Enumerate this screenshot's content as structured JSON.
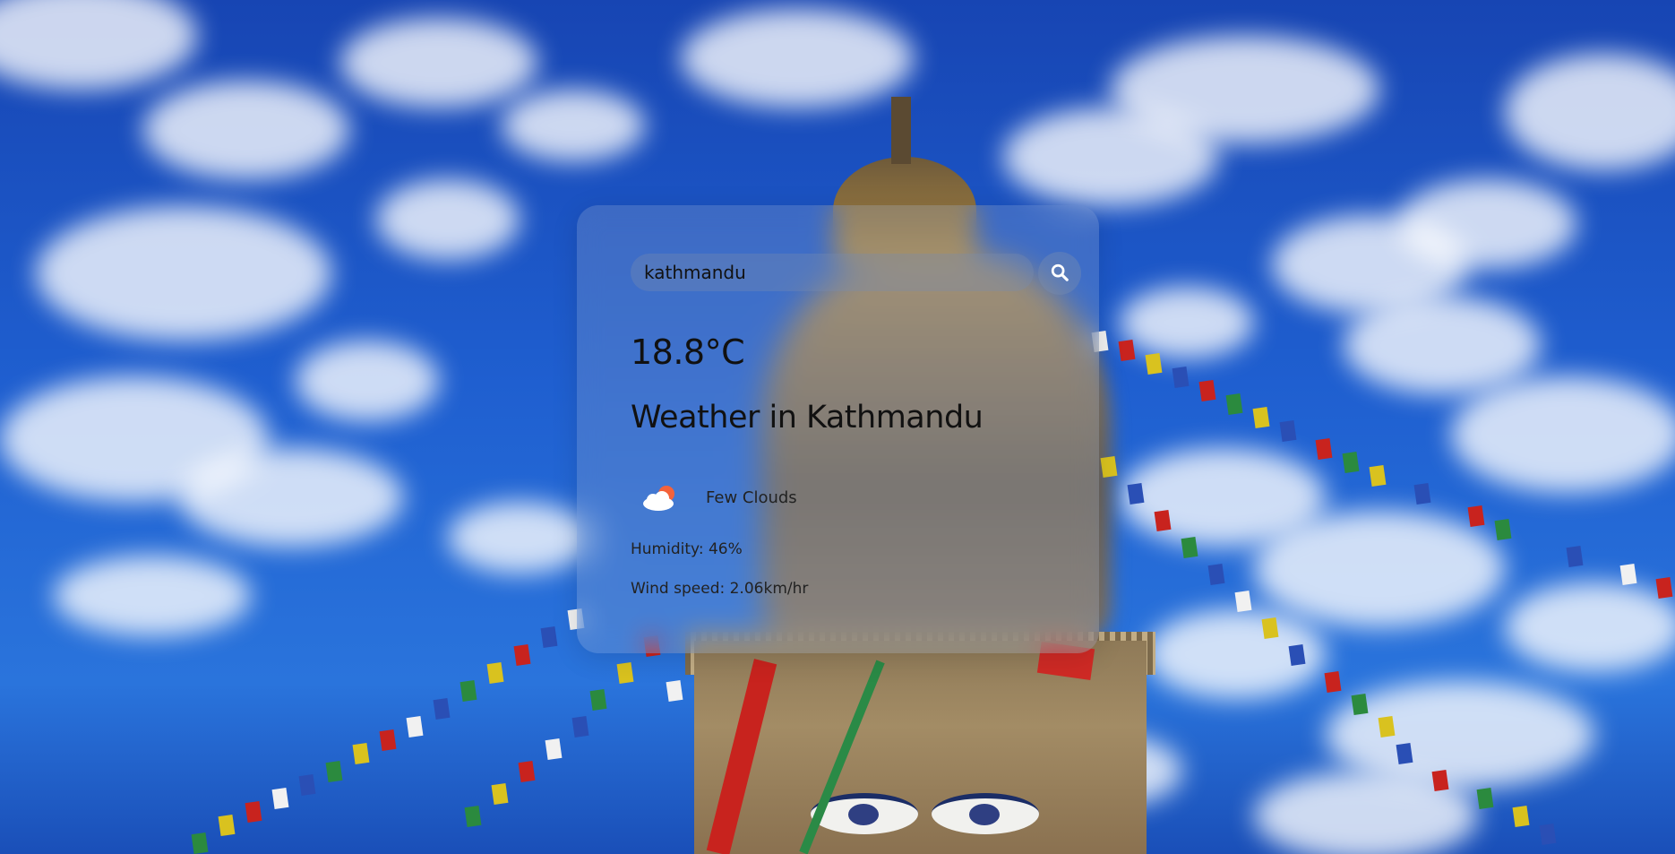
{
  "search": {
    "value": "kathmandu"
  },
  "weather": {
    "temperature": "18.8°C",
    "title": "Weather in Kathmandu",
    "condition": "Few Clouds",
    "condition_icon": "few-clouds-icon",
    "humidity": "Humidity: 46%",
    "wind_speed": "Wind speed: 2.06km/hr"
  },
  "colors": {
    "sky": "#1f5fd0",
    "text": "#111111",
    "sun": "#f4623a"
  }
}
